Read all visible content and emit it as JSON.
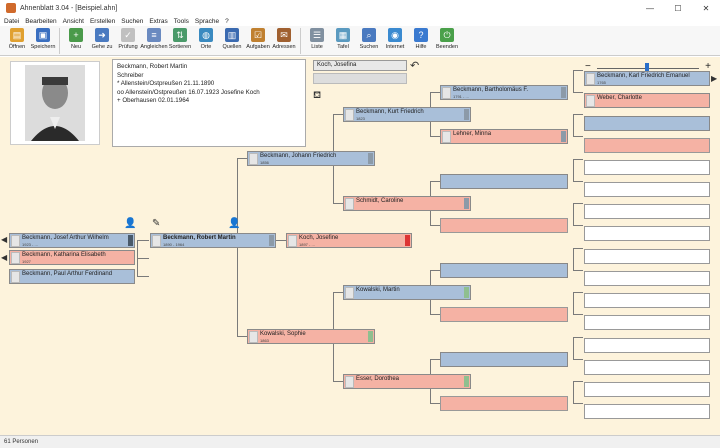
{
  "window": {
    "title": "Ahnenblatt 3.04 - [Beispiel.ahn]",
    "min": "—",
    "max": "☐",
    "close": "✕"
  },
  "menu": [
    "Datei",
    "Bearbeiten",
    "Ansicht",
    "Erstellen",
    "Suchen",
    "Extras",
    "Tools",
    "Sprache",
    "?"
  ],
  "toolbar": [
    {
      "label": "Öffnen",
      "icon": "folder-icon",
      "color": "#e0a030"
    },
    {
      "label": "Speichern",
      "icon": "save-icon",
      "color": "#3a6fc0"
    },
    {
      "label": "Neu",
      "icon": "new-person-icon",
      "color": "#4a9a4a"
    },
    {
      "label": "Gehe zu",
      "icon": "goto-icon",
      "color": "#4a7ac0"
    },
    {
      "label": "Prüfung",
      "icon": "check-icon",
      "color": "#c0c0c0"
    },
    {
      "label": "Angleichen",
      "icon": "align-icon",
      "color": "#6a8ac0"
    },
    {
      "label": "Sortieren",
      "icon": "sort-icon",
      "color": "#4a9a6a"
    },
    {
      "label": "Orte",
      "icon": "globe-icon",
      "color": "#3a8ac0"
    },
    {
      "label": "Quellen",
      "icon": "book-icon",
      "color": "#3a6ab0"
    },
    {
      "label": "Aufgaben",
      "icon": "tasks-icon",
      "color": "#c08030"
    },
    {
      "label": "Adressen",
      "icon": "address-icon",
      "color": "#a06030"
    },
    {
      "label": "Liste",
      "icon": "list-icon",
      "color": "#8090a0"
    },
    {
      "label": "Tafel",
      "icon": "chart-icon",
      "color": "#5a9ac0"
    },
    {
      "label": "Suchen",
      "icon": "search-icon",
      "color": "#4a7ac0"
    },
    {
      "label": "Internet",
      "icon": "internet-icon",
      "color": "#3a8ad0"
    },
    {
      "label": "Hilfe",
      "icon": "help-icon",
      "color": "#3a7ad0"
    },
    {
      "label": "Beenden",
      "icon": "exit-icon",
      "color": "#4aa04a"
    }
  ],
  "info": {
    "name": "Beckmann, Robert Martin",
    "occupation": "Schreiber",
    "birth": "* Allenstein/Ostpreußen 21.11.1890",
    "marriage": "oo Allenstein/Ostpreußen 16.07.1923 Josefine Koch",
    "death": "+ Oberhausen 02.01.1964"
  },
  "spouse_select": "Koch, Josefina",
  "status": "61 Personen",
  "persons": [
    {
      "name": "Beckmann, Josef Arthur Wilhelm",
      "year": "1923 - ...",
      "sex": "male"
    },
    {
      "name": "Beckmann, Katharina Elisabeth",
      "year": "1927",
      "sex": "female"
    },
    {
      "name": "Beckmann, Paul Arthur Ferdinand",
      "year": "",
      "sex": "male"
    },
    {
      "name": "Beckmann, Robert Martin",
      "year": "1890 - 1964",
      "sex": "male"
    },
    {
      "name": "Koch, Josefine",
      "year": "1897 - ...",
      "sex": "female"
    },
    {
      "name": "Beckmann, Johann Friedrich",
      "year": "1856",
      "sex": "male"
    },
    {
      "name": "Kowalski, Sophie",
      "year": "1863",
      "sex": "female"
    },
    {
      "name": "Beckmann, Kurt Friedrich",
      "year": "1823",
      "sex": "male"
    },
    {
      "name": "Schmidt, Caroline",
      "year": "",
      "sex": "female"
    },
    {
      "name": "Kowalski, Martin",
      "year": "",
      "sex": "male"
    },
    {
      "name": "Esser, Dorothea",
      "year": "",
      "sex": "female"
    },
    {
      "name": "Beckmann, Bartholomäus F.",
      "year": "1791 - ...",
      "sex": "male"
    },
    {
      "name": "Lehner, Minna",
      "year": "",
      "sex": "female"
    },
    {
      "name": "Beckmann, Karl Friedrich Emanuel",
      "year": "1765",
      "sex": "male"
    },
    {
      "name": "Weber, Charlotte",
      "year": "",
      "sex": "female"
    }
  ]
}
